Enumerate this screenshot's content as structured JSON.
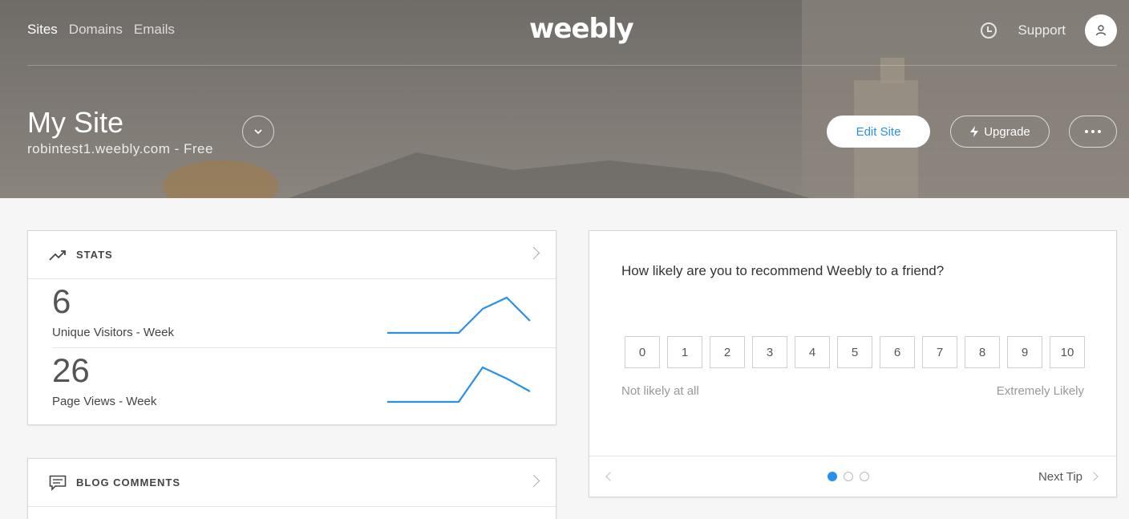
{
  "nav": {
    "items": [
      {
        "label": "Sites",
        "active": true
      },
      {
        "label": "Domains",
        "active": false
      },
      {
        "label": "Emails",
        "active": false
      }
    ],
    "logo_text": "weebly",
    "support_label": "Support"
  },
  "site": {
    "title": "My Site",
    "url": "robintest1.weebly.com - Free",
    "edit_label": "Edit Site",
    "upgrade_label": "Upgrade"
  },
  "stats": {
    "title": "STATS",
    "rows": [
      {
        "value": "6",
        "label": "Unique Visitors - Week"
      },
      {
        "value": "26",
        "label": "Page Views - Week"
      }
    ]
  },
  "blog": {
    "title": "BLOG COMMENTS"
  },
  "survey": {
    "question": "How likely are you to recommend Weebly to a friend?",
    "scale": [
      "0",
      "1",
      "2",
      "3",
      "4",
      "5",
      "6",
      "7",
      "8",
      "9",
      "10"
    ],
    "low_label": "Not likely at all",
    "high_label": "Extremely Likely",
    "next_label": "Next Tip",
    "page_count": 3,
    "current_page": 1
  },
  "colors": {
    "accent": "#2990ea"
  }
}
